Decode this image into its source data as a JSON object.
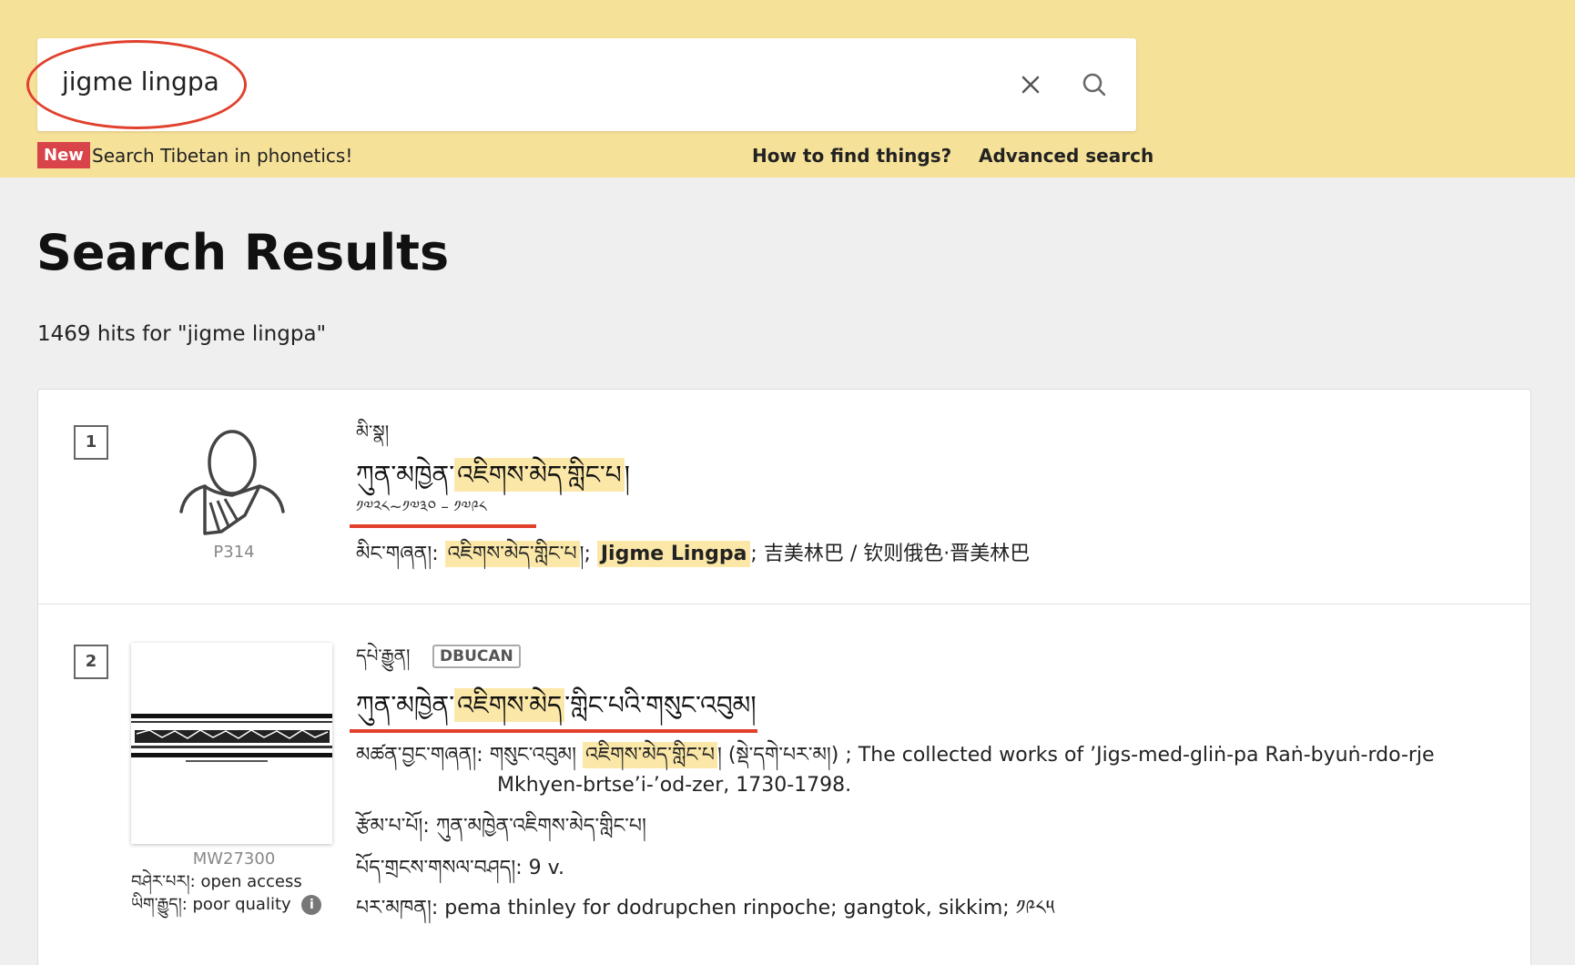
{
  "search": {
    "query": "jigme lingpa",
    "new_badge": "New",
    "promo_text": "Search Tibetan in phonetics!",
    "how_to_link": "How to find things?",
    "advanced_link": "Advanced search"
  },
  "page": {
    "title": "Search Results",
    "hits_text": "1469 hits for \"jigme lingpa\""
  },
  "results": [
    {
      "number": "1",
      "thumbnail_id": "P314",
      "type_label": "མི་སྣ།",
      "title_prefix": "ཀུན་མཁྱེན་",
      "title_highlight": "འཇིགས་མེད་གླིང་པ",
      "title_suffix": "།",
      "dates": "༡༧༢༨~༡༧༣༠ – ༡༧༩༨",
      "names_label": "མིང་གཞན།:",
      "names_tib_highlight": "འཇིགས་མེད་གླིང་པ",
      "names_sep1": "།;",
      "names_en_highlight": "Jigme Lingpa",
      "names_rest": "; 吉美林巴 / 钦则俄色·晋美林巴"
    },
    {
      "number": "2",
      "thumbnail_id": "MW27300",
      "type_label": "དཔེ་རྒྱུན།",
      "tag": "DBUCAN",
      "title_prefix": "ཀུན་མཁྱེན་",
      "title_highlight": "འཇིགས་མེད",
      "title_suffix": "་གླིང་པའི་གསུང་འབུམ།",
      "alt_title_label": "མཚན་བྱང་གཞན།:",
      "alt_title_prefix": "གསུང་འབུམ།",
      "alt_title_highlight": "འཇིགས་མེད་གླིང་པ",
      "alt_title_mid": "། (སྡེ་དགེ་པར་མ།)",
      "alt_title_en_line1": "; The collected works of ’Jigs-med-gliṅ-pa Raṅ-byuṅ-rdo-rje",
      "alt_title_en_line2": "Mkhyen-brtse’i-’od-zer, 1730-1798.",
      "author_label": "རྩོམ་པ་པོ།:",
      "author_value": "ཀུན་མཁྱེན་འཇིགས་མེད་གླིང་པ།",
      "volumes_label": "པོད་གྲངས་གསལ་བཤད།:",
      "volumes_value": "9 v.",
      "publisher_label": "པར་མཁན།:",
      "publisher_value": "pema thinley for dodrupchen rinpoche; gangtok, sikkim; ༡༩༨༥",
      "access_label": "བཤེར་པར།:",
      "access_value": "open access",
      "quality_label": "ཡིག་རྒྱུད།:",
      "quality_value": "poor quality",
      "info_icon_char": "i"
    }
  ],
  "icons": {
    "clear": "close-icon",
    "search": "search-icon",
    "person": "person-silhouette-icon",
    "info": "info-icon"
  },
  "colors": {
    "topbar": "#f6e199",
    "highlight": "#fbe8a8",
    "annotation_red": "#e0402c",
    "new_badge": "#d9434a"
  }
}
